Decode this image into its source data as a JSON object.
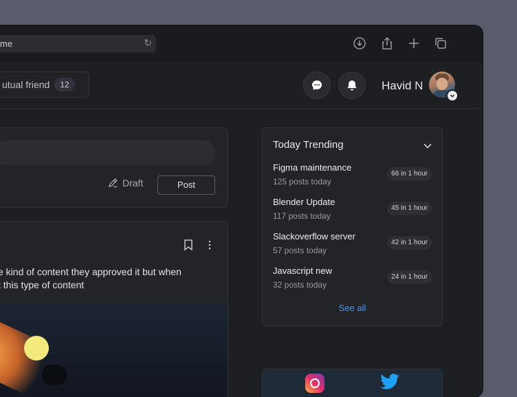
{
  "browser": {
    "url_text": "me"
  },
  "header": {
    "mutual_label": "utual friend",
    "mutual_count": "12",
    "username": "Havid N"
  },
  "composer": {
    "draft_label": "Draft",
    "post_label": "Post"
  },
  "post": {
    "text_line1": "e kind of content they approved it but when",
    "text_line2": "t this type of content"
  },
  "trending": {
    "title": "Today Trending",
    "items": [
      {
        "name": "Figma maintenance",
        "count": "125 posts today",
        "rate": "66 in 1 hour"
      },
      {
        "name": "Blender Update",
        "count": "117 posts today",
        "rate": "45 in 1 hour"
      },
      {
        "name": "Slackoverflow server",
        "count": "57 posts today",
        "rate": "42 in 1 hour"
      },
      {
        "name": "Javascript new",
        "count": "32 posts today",
        "rate": "24 in 1 hour"
      }
    ],
    "see_all": "See all"
  },
  "icons": [
    "reload-icon",
    "download-icon",
    "share-icon",
    "plus-icon",
    "tabs-icon",
    "chat-icon",
    "bell-icon",
    "chevron-down-icon",
    "edit-icon",
    "bookmark-icon",
    "more-icon",
    "instagram-icon",
    "twitter-icon"
  ]
}
